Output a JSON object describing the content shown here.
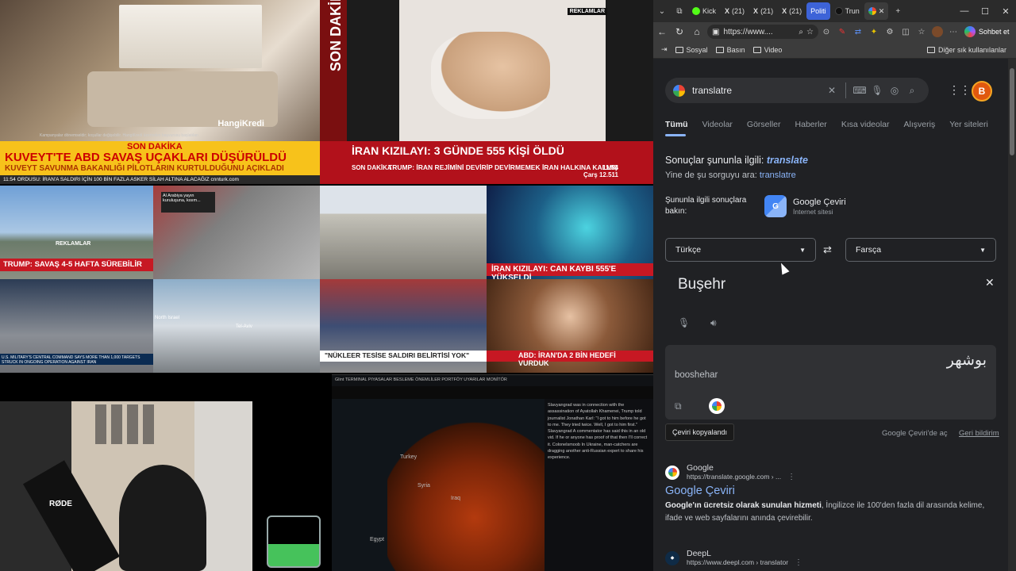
{
  "left_feeds": {
    "interior_logo": "HangiKredi",
    "interior_fine": "Kampanyalar dönemseldir; koşullar değişebilir. HangiKredi üzerinden başvurusu başlatılan",
    "bed_vertical": "SON DAKİKA",
    "bed_badge": "REKLAMLAR",
    "yellow_top": "SON DAKİKA",
    "yellow_head": "KUVEYT'TE ABD SAVAŞ UÇAKLARI DÜŞÜRÜLDÜ",
    "yellow_sub": "KUVEYT SAVUNMA BAKANLIĞI PİLOTLARIN KURTULDUĞUNU AÇIKLADI",
    "yellow_ticker": "11:54  ORDUSU: İRAN'A SALDIRI İÇİN 100 BİN FAZLA ASKER SİLAH ALTINA ALACAĞIZ   cnnturk.com",
    "red_head": "İRAN KIZILAYI: 3 GÜNDE 555 KİŞİ ÖLDÜ",
    "red_left": "SON DAKİKA",
    "red_mid": "TRUMP: İRAN REJİMİNİ DEVİRİP DEVİRMEMEK İRAN HALKINA KALMIŞ",
    "red_time": "11:54",
    "red_date": "Çarş 12.511",
    "g1_strap": "TRUMP: SAVAŞ 4-5 HAFTA SÜREBİLİR",
    "g1_sub": "REKLAMLAR",
    "g2_card": "Al Arabiya yayın kuruluşuna, kısım...",
    "g4_strap": "İRAN KIZILAYI: CAN KAYBI 555'E YÜKSELDİ",
    "g5_bot": "U.S. MILITARY'S CENTRAL COMMAND SAYS MORE THAN 1,000 TARGETS STRUCK IN ONGOING OPERATION AGAINST IRAN",
    "g6_label1": "North Israel",
    "g6_label2": "Tel-Aviv",
    "g7_strap": "\"NÜKLEER TESİSE SALDIRI BELİRTİSİ YOK\"",
    "g8_strap": "ABD: İRAN'DA 2 BİN HEDEFİ VURDUK",
    "cam_brand": "RØDE",
    "map_topbar": "Glint  TERMINAL  PIYASALAR  BESLEME  ÖNEMLİLER  PORTFÖY  UYARILAR  MONİTÖR",
    "map_label1": "Turkey",
    "map_label2": "Syria",
    "map_label3": "Iraq",
    "map_label4": "Egypt",
    "map_side": "Slavyangrad\nwas in connection with the assassination of Ayatollah Khamenei, Trump told journalist Jonathan Karl: \"I got to him before he got to me. They tried twice. Well, I got to him first.\"\nSlavyangrad\nA commentator has said this in an old vid. If he or anyone has proof of that then I'll correct it.\nColonelsmoob\nIn Ukraine, man-catchers are dragging another anti-Russian expert to share his experience."
  },
  "browser": {
    "tabs": [
      {
        "label": "Kick",
        "color": "#53fc18"
      },
      {
        "label": "(21)",
        "color": "#ffffff"
      },
      {
        "label": "(21)",
        "color": "#ffffff"
      },
      {
        "label": "(21)",
        "color": "#ffffff"
      },
      {
        "label": "Politi",
        "color": "#3d63d8"
      },
      {
        "label": "Trun",
        "color": "#1a1a1a"
      }
    ],
    "address": "https://www....",
    "copilot_label": "Sohbet et",
    "bookmarks": [
      "Sosyal",
      "Basın",
      "Video"
    ],
    "bookmarks_right": "Diğer sık kullanılanlar",
    "search_query": "translatre",
    "avatar_letter": "B",
    "vertical_tabs": [
      "Tümü",
      "Videolar",
      "Görseller",
      "Haberler",
      "Kısa videolar",
      "Alışveriş",
      "Yer siteleri"
    ],
    "correction_prefix": "Sonuçlar şununla ilgili: ",
    "correction_word": "translate",
    "requery_prefix": "Yine de şu sorguyu ara: ",
    "requery_word": "translatre",
    "related_label": "Şununla ilgili sonuçlara bakın:",
    "related_title": "Google Çeviri",
    "related_sub": "İnternet sitesi",
    "source_lang": "Türkçe",
    "target_lang": "Farsça",
    "source_text": "Buşehr",
    "target_text": "بوشهر",
    "transliteration": "booshehar",
    "tooltip": "Çeviri kopyalandı",
    "open_in_translate": "Google Çeviri'de aç",
    "feedback": "Geri bildirim",
    "results": [
      {
        "site": "Google",
        "url": "https://translate.google.com › ...",
        "title": "Google Çeviri",
        "snippet_bold": "Google'ın ücretsiz olarak sunulan hizmeti",
        "snippet_rest": ", İngilizce ile 100'den fazla dil arasında kelime, ifade ve web sayfalarını anında çevirebilir."
      },
      {
        "site": "DeepL",
        "url": "https://www.deepl.com › translator"
      }
    ]
  },
  "colors": {
    "accent_link": "#8ab4f8",
    "breaking_red": "#b2111b",
    "breaking_yellow": "#f7c21b"
  }
}
